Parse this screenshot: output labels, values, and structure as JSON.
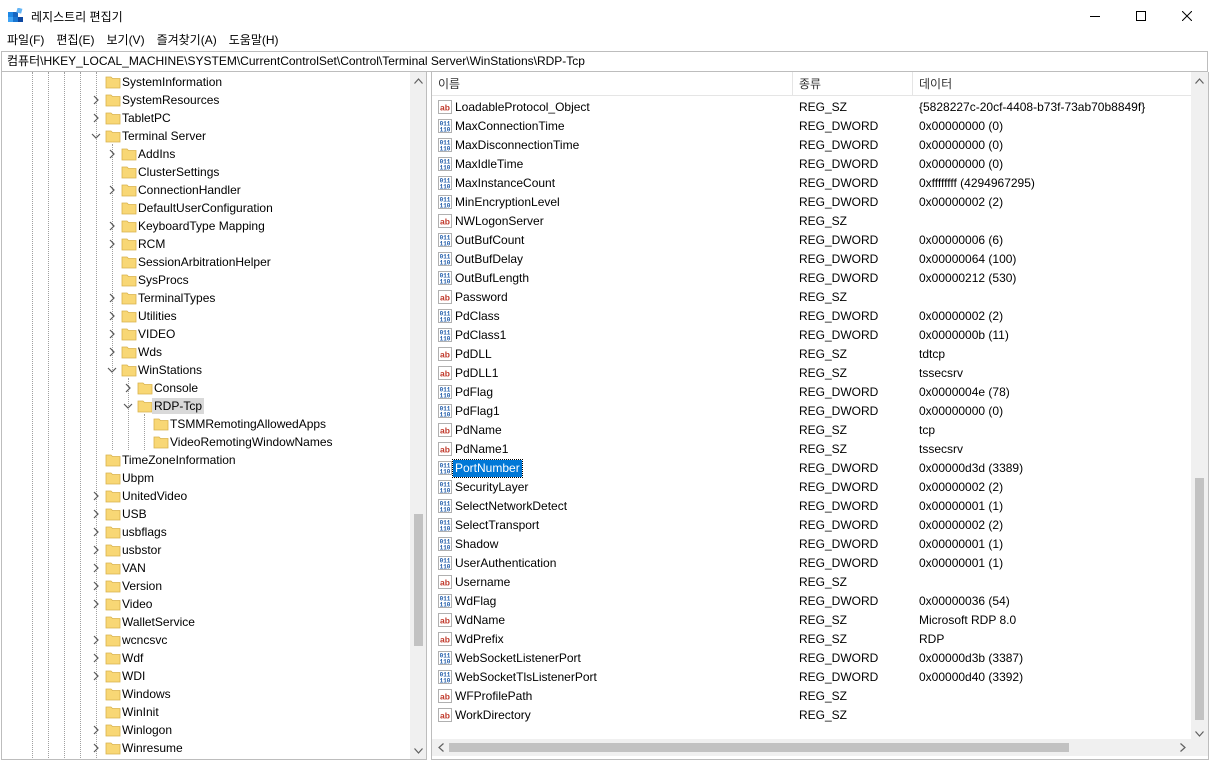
{
  "window": {
    "title": "레지스트리 편집기",
    "minimize_label": "minimize",
    "maximize_label": "maximize",
    "close_label": "close"
  },
  "menu": [
    "파일(F)",
    "편집(E)",
    "보기(V)",
    "즐겨찾기(A)",
    "도움말(H)"
  ],
  "address": "컴퓨터\\HKEY_LOCAL_MACHINE\\SYSTEM\\CurrentControlSet\\Control\\Terminal Server\\WinStations\\RDP-Tcp",
  "tree": [
    {
      "label": "SystemInformation",
      "level": 0,
      "expander": "none"
    },
    {
      "label": "SystemResources",
      "level": 0,
      "expander": "collapsed"
    },
    {
      "label": "TabletPC",
      "level": 0,
      "expander": "collapsed"
    },
    {
      "label": "Terminal Server",
      "level": 0,
      "expander": "expanded"
    },
    {
      "label": "AddIns",
      "level": 1,
      "expander": "collapsed"
    },
    {
      "label": "ClusterSettings",
      "level": 1,
      "expander": "none"
    },
    {
      "label": "ConnectionHandler",
      "level": 1,
      "expander": "collapsed"
    },
    {
      "label": "DefaultUserConfiguration",
      "level": 1,
      "expander": "none"
    },
    {
      "label": "KeyboardType Mapping",
      "level": 1,
      "expander": "collapsed"
    },
    {
      "label": "RCM",
      "level": 1,
      "expander": "collapsed"
    },
    {
      "label": "SessionArbitrationHelper",
      "level": 1,
      "expander": "none"
    },
    {
      "label": "SysProcs",
      "level": 1,
      "expander": "none"
    },
    {
      "label": "TerminalTypes",
      "level": 1,
      "expander": "collapsed"
    },
    {
      "label": "Utilities",
      "level": 1,
      "expander": "collapsed"
    },
    {
      "label": "VIDEO",
      "level": 1,
      "expander": "collapsed"
    },
    {
      "label": "Wds",
      "level": 1,
      "expander": "collapsed"
    },
    {
      "label": "WinStations",
      "level": 1,
      "expander": "expanded"
    },
    {
      "label": "Console",
      "level": 2,
      "expander": "collapsed"
    },
    {
      "label": "RDP-Tcp",
      "level": 2,
      "expander": "expanded",
      "selected": true
    },
    {
      "label": "TSMMRemotingAllowedApps",
      "level": 3,
      "expander": "none"
    },
    {
      "label": "VideoRemotingWindowNames",
      "level": 3,
      "expander": "none"
    },
    {
      "label": "TimeZoneInformation",
      "level": 0,
      "expander": "none"
    },
    {
      "label": "Ubpm",
      "level": 0,
      "expander": "none"
    },
    {
      "label": "UnitedVideo",
      "level": 0,
      "expander": "collapsed"
    },
    {
      "label": "USB",
      "level": 0,
      "expander": "collapsed"
    },
    {
      "label": "usbflags",
      "level": 0,
      "expander": "collapsed"
    },
    {
      "label": "usbstor",
      "level": 0,
      "expander": "collapsed"
    },
    {
      "label": "VAN",
      "level": 0,
      "expander": "collapsed"
    },
    {
      "label": "Version",
      "level": 0,
      "expander": "collapsed"
    },
    {
      "label": "Video",
      "level": 0,
      "expander": "collapsed"
    },
    {
      "label": "WalletService",
      "level": 0,
      "expander": "none"
    },
    {
      "label": "wcncsvc",
      "level": 0,
      "expander": "collapsed"
    },
    {
      "label": "Wdf",
      "level": 0,
      "expander": "collapsed"
    },
    {
      "label": "WDI",
      "level": 0,
      "expander": "collapsed"
    },
    {
      "label": "Windows",
      "level": 0,
      "expander": "none"
    },
    {
      "label": "WinInit",
      "level": 0,
      "expander": "none"
    },
    {
      "label": "Winlogon",
      "level": 0,
      "expander": "collapsed"
    },
    {
      "label": "Winresume",
      "level": 0,
      "expander": "collapsed"
    }
  ],
  "columns": {
    "name": "이름",
    "type": "종류",
    "data": "데이터"
  },
  "values": [
    {
      "name": "LoadableProtocol_Object",
      "type": "REG_SZ",
      "data": "{5828227c-20cf-4408-b73f-73ab70b8849f}",
      "icon": "string"
    },
    {
      "name": "MaxConnectionTime",
      "type": "REG_DWORD",
      "data": "0x00000000 (0)",
      "icon": "binary"
    },
    {
      "name": "MaxDisconnectionTime",
      "type": "REG_DWORD",
      "data": "0x00000000 (0)",
      "icon": "binary"
    },
    {
      "name": "MaxIdleTime",
      "type": "REG_DWORD",
      "data": "0x00000000 (0)",
      "icon": "binary"
    },
    {
      "name": "MaxInstanceCount",
      "type": "REG_DWORD",
      "data": "0xffffffff (4294967295)",
      "icon": "binary"
    },
    {
      "name": "MinEncryptionLevel",
      "type": "REG_DWORD",
      "data": "0x00000002 (2)",
      "icon": "binary"
    },
    {
      "name": "NWLogonServer",
      "type": "REG_SZ",
      "data": "",
      "icon": "string"
    },
    {
      "name": "OutBufCount",
      "type": "REG_DWORD",
      "data": "0x00000006 (6)",
      "icon": "binary"
    },
    {
      "name": "OutBufDelay",
      "type": "REG_DWORD",
      "data": "0x00000064 (100)",
      "icon": "binary"
    },
    {
      "name": "OutBufLength",
      "type": "REG_DWORD",
      "data": "0x00000212 (530)",
      "icon": "binary"
    },
    {
      "name": "Password",
      "type": "REG_SZ",
      "data": "",
      "icon": "string"
    },
    {
      "name": "PdClass",
      "type": "REG_DWORD",
      "data": "0x00000002 (2)",
      "icon": "binary"
    },
    {
      "name": "PdClass1",
      "type": "REG_DWORD",
      "data": "0x0000000b (11)",
      "icon": "binary"
    },
    {
      "name": "PdDLL",
      "type": "REG_SZ",
      "data": "tdtcp",
      "icon": "string"
    },
    {
      "name": "PdDLL1",
      "type": "REG_SZ",
      "data": "tssecsrv",
      "icon": "string"
    },
    {
      "name": "PdFlag",
      "type": "REG_DWORD",
      "data": "0x0000004e (78)",
      "icon": "binary"
    },
    {
      "name": "PdFlag1",
      "type": "REG_DWORD",
      "data": "0x00000000 (0)",
      "icon": "binary"
    },
    {
      "name": "PdName",
      "type": "REG_SZ",
      "data": "tcp",
      "icon": "string"
    },
    {
      "name": "PdName1",
      "type": "REG_SZ",
      "data": "tssecsrv",
      "icon": "string"
    },
    {
      "name": "PortNumber",
      "type": "REG_DWORD",
      "data": "0x00000d3d (3389)",
      "icon": "binary",
      "selected": true
    },
    {
      "name": "SecurityLayer",
      "type": "REG_DWORD",
      "data": "0x00000002 (2)",
      "icon": "binary"
    },
    {
      "name": "SelectNetworkDetect",
      "type": "REG_DWORD",
      "data": "0x00000001 (1)",
      "icon": "binary"
    },
    {
      "name": "SelectTransport",
      "type": "REG_DWORD",
      "data": "0x00000002 (2)",
      "icon": "binary"
    },
    {
      "name": "Shadow",
      "type": "REG_DWORD",
      "data": "0x00000001 (1)",
      "icon": "binary"
    },
    {
      "name": "UserAuthentication",
      "type": "REG_DWORD",
      "data": "0x00000001 (1)",
      "icon": "binary"
    },
    {
      "name": "Username",
      "type": "REG_SZ",
      "data": "",
      "icon": "string"
    },
    {
      "name": "WdFlag",
      "type": "REG_DWORD",
      "data": "0x00000036 (54)",
      "icon": "binary"
    },
    {
      "name": "WdName",
      "type": "REG_SZ",
      "data": "Microsoft RDP 8.0",
      "icon": "string"
    },
    {
      "name": "WdPrefix",
      "type": "REG_SZ",
      "data": "RDP",
      "icon": "string"
    },
    {
      "name": "WebSocketListenerPort",
      "type": "REG_DWORD",
      "data": "0x00000d3b (3387)",
      "icon": "binary"
    },
    {
      "name": "WebSocketTlsListenerPort",
      "type": "REG_DWORD",
      "data": "0x00000d40 (3392)",
      "icon": "binary"
    },
    {
      "name": "WFProfilePath",
      "type": "REG_SZ",
      "data": "",
      "icon": "string"
    },
    {
      "name": "WorkDirectory",
      "type": "REG_SZ",
      "data": "",
      "icon": "string"
    }
  ],
  "colors": {
    "selection": "#0078d7",
    "tree_selection": "#d9d9d9",
    "folder": "#f8d775",
    "string_icon": "#c0392b",
    "binary_icon": "#1e5aa8"
  }
}
